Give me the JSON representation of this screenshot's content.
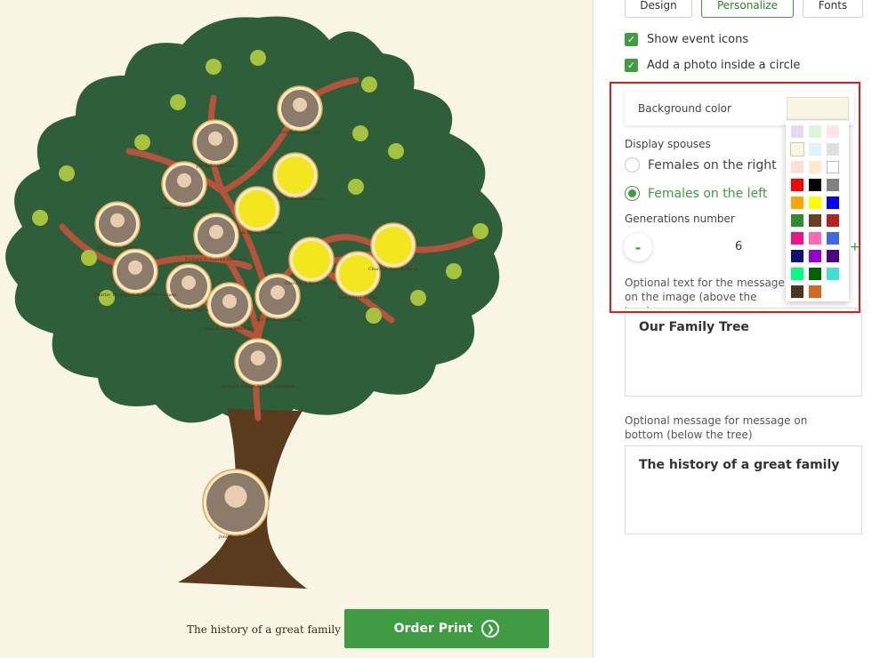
{
  "tree": {
    "people": [
      {
        "name": "Jennifer Brown",
        "type": "photo"
      },
      {
        "name": "Michael Brown & Julie Smithson",
        "type": "photo"
      },
      {
        "name": "Earl & Mary Smithson",
        "type": "photo"
      },
      {
        "name": "Carl & Marge Brown",
        "type": "photo"
      },
      {
        "name": "Jim & Lila Wilson",
        "type": "photo"
      },
      {
        "name": "Charlie Thompson & Martha Benson",
        "type": "photo"
      },
      {
        "name": "Bill & Julia Wilson",
        "type": "photo"
      },
      {
        "name": "Adam & Jessie Brown",
        "type": "photo"
      },
      {
        "name": "Joe & Iris Brown",
        "type": "photo"
      },
      {
        "name": "Dan & Ivan Brown",
        "type": "photo"
      },
      {
        "name": "Andrew & Stella Robinson",
        "type": "text"
      },
      {
        "name": "Joe & Lucia Robinson",
        "type": "text"
      },
      {
        "name": "Richard & Sandra Robinson",
        "type": "photo"
      },
      {
        "name": "Edward & Jane Johnson",
        "type": "text"
      },
      {
        "name": "Ron White & Ella",
        "type": "text"
      },
      {
        "name": "Chuck & Amy Roberts",
        "type": "text"
      }
    ]
  },
  "canvas": {
    "bottom_message": "The history of a great family",
    "order_button": "Order Print"
  },
  "tabs": [
    {
      "label": "Design",
      "active": false
    },
    {
      "label": "Personalize",
      "active": true
    },
    {
      "label": "Fonts",
      "active": false
    }
  ],
  "options": {
    "show_event_icons": {
      "label": "Show event icons",
      "checked": true
    },
    "add_photo": {
      "label": "Add a photo inside a circle",
      "checked": true
    }
  },
  "background": {
    "label": "Background color",
    "selected": "#f8f5e4"
  },
  "spouses": {
    "label": "Display spouses",
    "options": [
      {
        "label": "Females on the right",
        "selected": false
      },
      {
        "label": "Females on the left",
        "selected": true
      }
    ]
  },
  "generations": {
    "label": "Generations number",
    "minus": "-",
    "value": "6",
    "plus": "+"
  },
  "top_text": {
    "label": "Optional text for the message on the image (above the tree)",
    "value": "Our Family Tree"
  },
  "bottom_text": {
    "label": "Optional message for message on bottom (below the tree)",
    "value": "The history of a great family"
  },
  "palette": [
    [
      "#e6d8f5",
      "#dcf3dc",
      "#fbe3e6"
    ],
    [
      "#f8f5e4",
      "#dff2fb",
      "#e0e0e0"
    ],
    [
      "#fbe0d8",
      "#fde9cc",
      "#ffffff"
    ],
    [
      "#ff0000",
      "#000000",
      "#808080"
    ],
    [
      "#ffa500",
      "#ffff00",
      "#0000ff"
    ],
    [
      "#2e8b2e",
      "#6b3e1f",
      "#b22222"
    ],
    [
      "#ee1288",
      "#ff69b4",
      "#4169e1"
    ],
    [
      "#0b0b7a",
      "#9400d3",
      "#4b0082"
    ],
    [
      "#00ff7f",
      "#006400",
      "#40e0d0"
    ],
    [
      "#4a3520",
      "#d2691e"
    ]
  ],
  "colors": {
    "accent": "#3f9c43",
    "highlight": "#e01b1b",
    "canvas_bg": "#f8f5e4",
    "trunk": "#5b3b1e",
    "branch": "#b5543a",
    "foliage": "#2e5e3a"
  }
}
